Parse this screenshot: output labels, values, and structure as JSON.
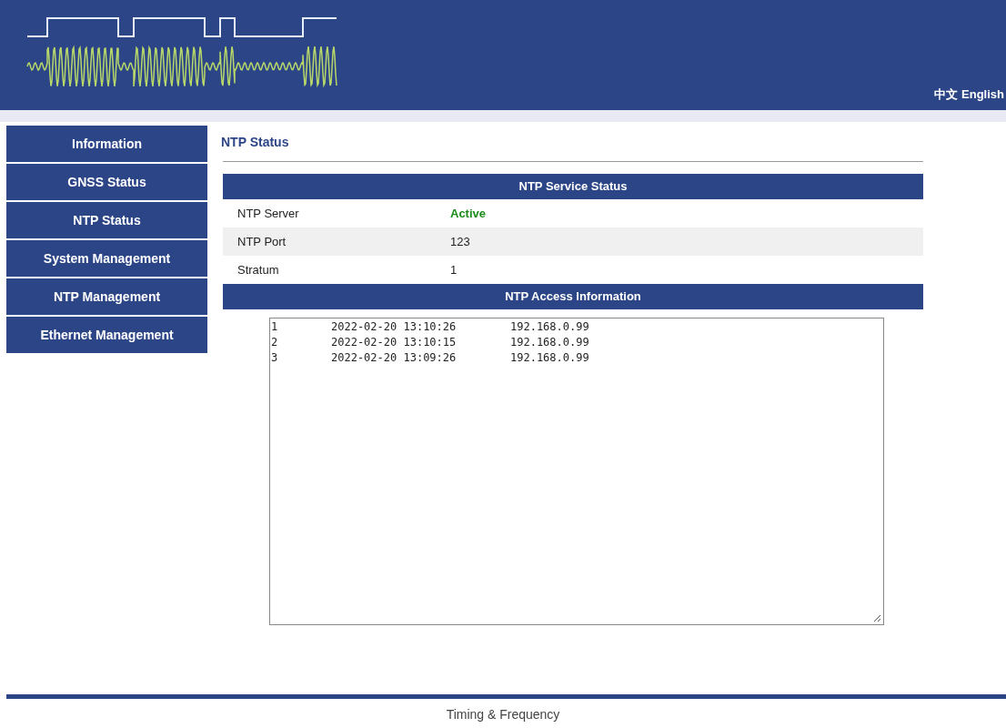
{
  "header": {
    "languages": [
      "中文",
      "English"
    ]
  },
  "sidebar": {
    "items": [
      "Information",
      "GNSS Status",
      "NTP Status",
      "System Management",
      "NTP Management",
      "Ethernet Management"
    ]
  },
  "page_title": "NTP Status",
  "service_status": {
    "heading": "NTP Service Status",
    "rows": [
      {
        "label": "NTP Server",
        "value": "Active",
        "kind": "status"
      },
      {
        "label": "NTP Port",
        "value": "123",
        "kind": "plain"
      },
      {
        "label": "Stratum",
        "value": "1",
        "kind": "plain"
      }
    ]
  },
  "access_info": {
    "heading": "NTP Access Information",
    "entries": [
      {
        "index": "1",
        "time": "2022-02-20 13:10:26",
        "address": "192.168.0.99"
      },
      {
        "index": "2",
        "time": "2022-02-20 13:10:15",
        "address": "192.168.0.99"
      },
      {
        "index": "3",
        "time": "2022-02-20 13:09:26",
        "address": "192.168.0.99"
      }
    ]
  },
  "footer": "Timing & Frequency"
}
